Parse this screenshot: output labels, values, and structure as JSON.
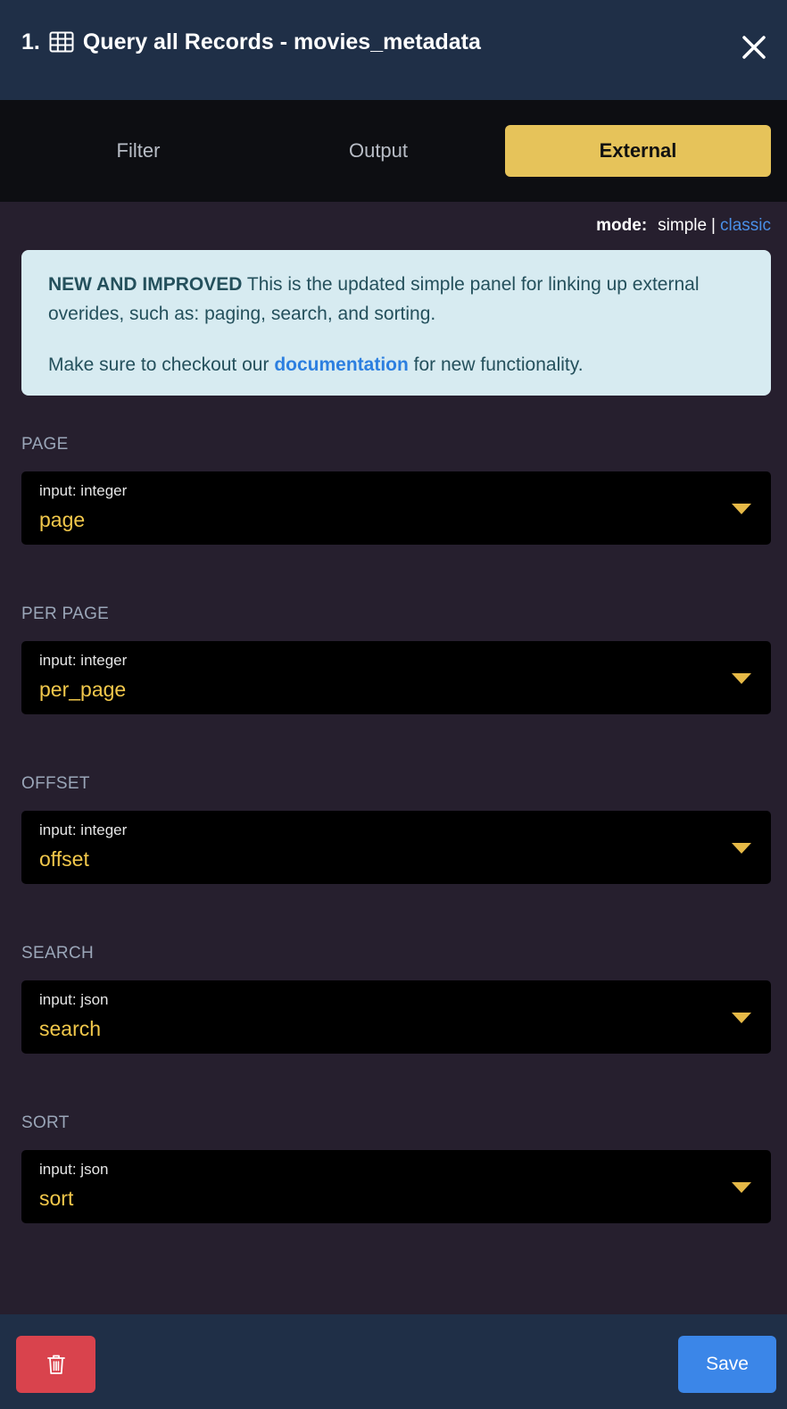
{
  "header": {
    "step_number": "1.",
    "icon": "table-icon",
    "title": "Query all Records - movies_metadata",
    "close_icon": "close-icon"
  },
  "tabs": [
    {
      "label": "Filter",
      "active": false
    },
    {
      "label": "Output",
      "active": false
    },
    {
      "label": "External",
      "active": true
    }
  ],
  "mode": {
    "label": "mode:",
    "simple": "simple",
    "separator": "|",
    "classic": "classic"
  },
  "info": {
    "strong": "NEW AND IMPROVED",
    "text": "This is the updated simple panel for linking up external overides, such as: paging, search, and sorting.",
    "line2_prefix": "Make sure to checkout our",
    "link": "documentation",
    "line2_suffix": "for new functionality."
  },
  "fields": [
    {
      "label": "PAGE",
      "type": "input: integer",
      "value": "page"
    },
    {
      "label": "PER PAGE",
      "type": "input: integer",
      "value": "per_page"
    },
    {
      "label": "OFFSET",
      "type": "input: integer",
      "value": "offset"
    },
    {
      "label": "SEARCH",
      "type": "input: json",
      "value": "search"
    },
    {
      "label": "SORT",
      "type": "input: json",
      "value": "sort"
    }
  ],
  "footer": {
    "delete_icon": "trash-icon",
    "save_label": "Save"
  },
  "colors": {
    "accent": "#e6c35a",
    "value_text": "#f2c84b",
    "link": "#4a8fe7",
    "delete": "#d9434d",
    "save": "#3b86e8"
  }
}
